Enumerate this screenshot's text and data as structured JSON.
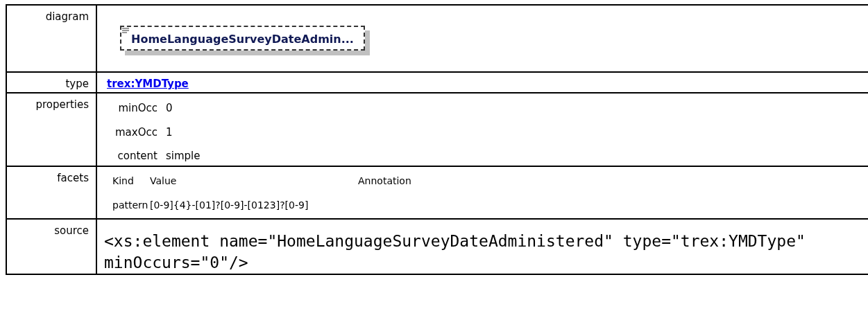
{
  "rows": [
    {
      "kind": "diagram",
      "label": "diagram",
      "element_name": "HomeLanguageSurveyDateAdmin..."
    },
    {
      "kind": "type",
      "label": "type",
      "link": "trex:YMDType"
    },
    {
      "kind": "properties",
      "label": "properties",
      "items": [
        {
          "name": "minOcc",
          "value": "0"
        },
        {
          "name": "maxOcc",
          "value": "1"
        },
        {
          "name": "content",
          "value": "simple"
        }
      ]
    },
    {
      "kind": "facets",
      "label": "facets",
      "columns": [
        "Kind",
        "Value",
        "Annotation"
      ],
      "facets": [
        {
          "kind": "pattern",
          "value": "[0-9]{4}-[01]?[0-9]-[0123]?[0-9]"
        }
      ]
    },
    {
      "kind": "source",
      "label": "source",
      "code": "<xs:element name=\"HomeLanguageSurveyDateAdministered\" type=\"trex:YMDType\" minOccurs=\"0\"/>"
    }
  ]
}
